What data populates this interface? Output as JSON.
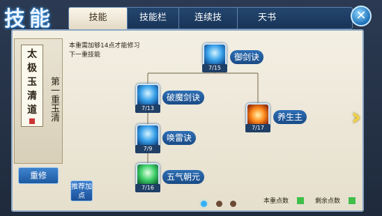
{
  "header": {
    "title": "技能",
    "tabs": [
      {
        "label": "技能",
        "active": true
      },
      {
        "label": "技能栏",
        "active": false
      },
      {
        "label": "连续技",
        "active": false
      },
      {
        "label": "天书",
        "active": false
      }
    ],
    "close_icon": "close-icon"
  },
  "left_panel": {
    "scroll_text": [
      "太",
      "极",
      "玉",
      "清",
      "道"
    ],
    "tier_text": "第一重玉清",
    "remake_button": "重修"
  },
  "main": {
    "description": "本重需加够14点才能修习下一重技能",
    "skills": [
      {
        "name": "御剑诀",
        "level": "7/15",
        "icon": "sword-aura-icon"
      },
      {
        "name": "破魔剑诀",
        "level": "7/13",
        "icon": "blade-wave-icon"
      },
      {
        "name": "养生主",
        "level": "7/17",
        "icon": "fire-orb-icon"
      },
      {
        "name": "唤雷诀",
        "level": "7/9",
        "icon": "lightning-icon"
      },
      {
        "name": "五气朝元",
        "level": "7/16",
        "icon": "healing-icon"
      }
    ],
    "recommend_button": "推荐加点",
    "page_indicator": {
      "total": 3,
      "current": 1
    },
    "stats": {
      "current_tier_points_label": "本重点数",
      "remaining_points_label": "剩余点数"
    }
  },
  "colors": {
    "accent_blue": "#1f3f66",
    "panel_bg": "#f3efe3",
    "arrow_gold": "#f2d441"
  }
}
